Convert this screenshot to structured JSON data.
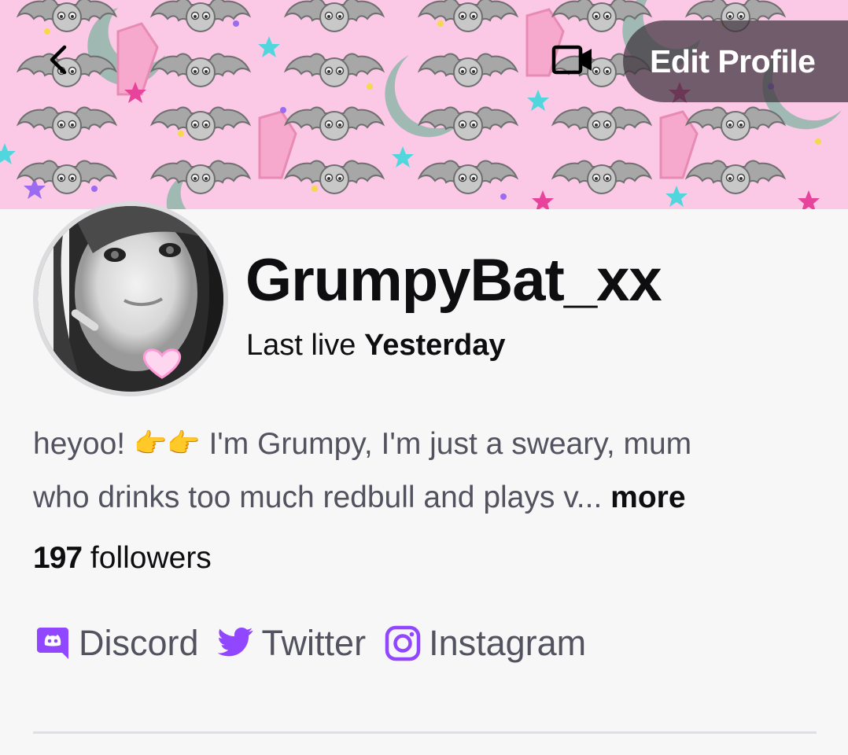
{
  "header": {
    "edit_profile_label": "Edit Profile"
  },
  "profile": {
    "username": "GrumpyBat_xx",
    "last_live_prefix": "Last live",
    "last_live_value": "Yesterday",
    "bio_line1_start": "heyoo!",
    "bio_line1_emoji": "👉👉",
    "bio_line1_end": "I'm Grumpy, I'm just a sweary, mum",
    "bio_line2": "who drinks too much redbull  and plays v...",
    "bio_more": "more",
    "followers_count": "197",
    "followers_label": "followers"
  },
  "socials": [
    {
      "label": "Discord",
      "icon": "discord-icon"
    },
    {
      "label": "Twitter",
      "icon": "twitter-icon"
    },
    {
      "label": "Instagram",
      "icon": "instagram-icon"
    }
  ],
  "colors": {
    "accent": "#9147ff",
    "banner_bg": "#fbc8e6",
    "text_primary": "#0e0e10",
    "text_secondary": "#53535f"
  }
}
